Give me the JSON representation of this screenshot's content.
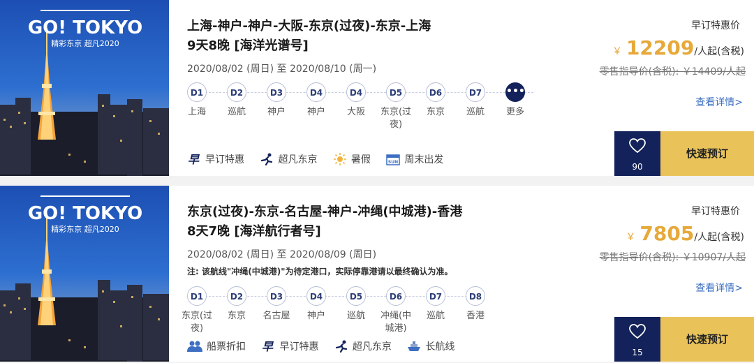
{
  "cards": [
    {
      "image_caption_main": "GO! TOKYO",
      "image_caption_sub": "精彩东京 超凡2020",
      "title_line1": "上海-神户-神户-大阪-东京(过夜)-东京-上海",
      "title_line2": "9天8晚 [海洋光谱号]",
      "dates": "2020/08/02 (周日) 至 2020/08/10 (周一)",
      "days": [
        {
          "code": "D1",
          "label": "上海"
        },
        {
          "code": "D2",
          "label": "巡航"
        },
        {
          "code": "D3",
          "label": "神户"
        },
        {
          "code": "D4",
          "label": "神户"
        },
        {
          "code": "D4",
          "label": "大阪"
        },
        {
          "code": "D5",
          "label": "东京(过夜)"
        },
        {
          "code": "D6",
          "label": "东京"
        },
        {
          "code": "D7",
          "label": "巡航"
        },
        {
          "code": "•••",
          "label": "更多"
        }
      ],
      "tags": [
        {
          "icon": "early-bird-icon",
          "label": "早订特惠"
        },
        {
          "icon": "runner-icon",
          "label": "超凡东京"
        },
        {
          "icon": "sun-icon",
          "label": "暑假"
        },
        {
          "icon": "calendar-sun-icon",
          "label": "周末出发"
        }
      ],
      "price_label": "早订特惠价",
      "currency": "￥",
      "price": "12209",
      "price_unit": "/人起(含税)",
      "orig_price": "零售指导价(含税): ￥14409/人起",
      "details_link": "查看详情>",
      "likes": "90",
      "book_label": "快速预订"
    },
    {
      "image_caption_main": "GO! TOKYO",
      "image_caption_sub": "精彩东京 超凡2020",
      "title_line1": "东京(过夜)-东京-名古屋-神户-冲绳(中城港)-香港",
      "title_line2": "8天7晚 [海洋航行者号]",
      "dates": "2020/08/02 (周日) 至 2020/08/09 (周日)",
      "note": "注: 该航线\"冲绳(中城港)\"为待定港口，实际停靠港请以最终确认为准。",
      "days": [
        {
          "code": "D1",
          "label": "东京(过夜)"
        },
        {
          "code": "D2",
          "label": "东京"
        },
        {
          "code": "D3",
          "label": "名古屋"
        },
        {
          "code": "D4",
          "label": "神户"
        },
        {
          "code": "D5",
          "label": "巡航"
        },
        {
          "code": "D6",
          "label": "冲绳(中城港)"
        },
        {
          "code": "D7",
          "label": "巡航"
        },
        {
          "code": "D8",
          "label": "香港"
        }
      ],
      "tags": [
        {
          "icon": "people-icon",
          "label": "船票折扣"
        },
        {
          "icon": "early-bird-icon",
          "label": "早订特惠"
        },
        {
          "icon": "runner-icon",
          "label": "超凡东京"
        },
        {
          "icon": "ship-icon",
          "label": "长航线"
        }
      ],
      "price_label": "早订特惠价",
      "currency": "￥",
      "price": "7805",
      "price_unit": "/人起(含税)",
      "orig_price": "零售指导价(含税): ￥10907/人起",
      "details_link": "查看详情>",
      "likes": "15",
      "book_label": "快速预订"
    }
  ],
  "colors": {
    "accent_gold": "#e6a93a",
    "navy": "#13225a",
    "book_yellow": "#e9c35a",
    "link_blue": "#3d6fc2"
  }
}
